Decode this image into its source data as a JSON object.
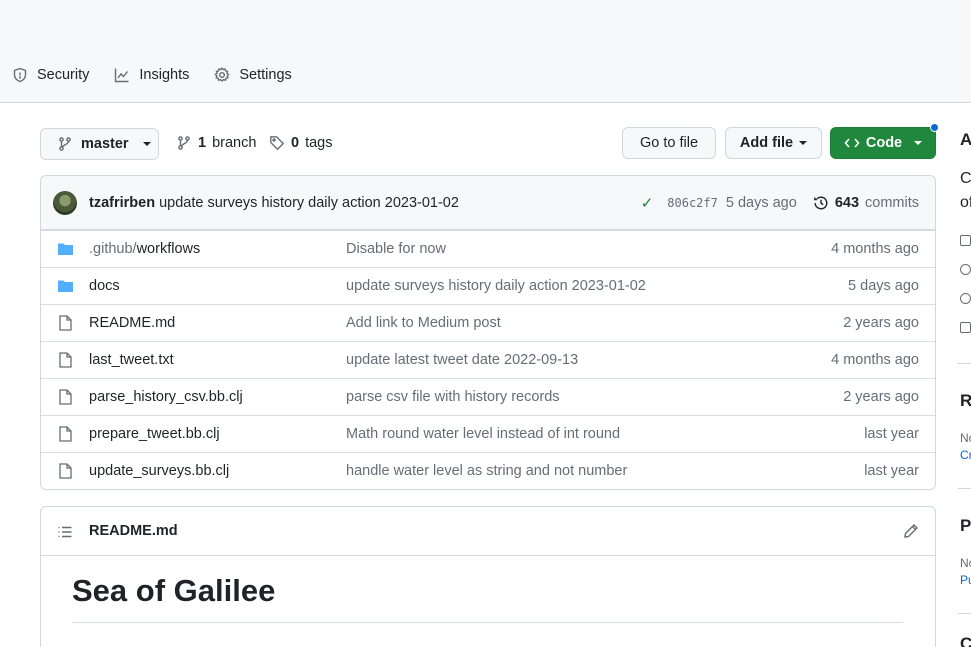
{
  "nav": {
    "items": [
      {
        "label": "Security",
        "icon": "shield-icon"
      },
      {
        "label": "Insights",
        "icon": "graph-icon"
      },
      {
        "label": "Settings",
        "icon": "gear-icon"
      }
    ]
  },
  "toolbar": {
    "branch": "master",
    "branch_count": "1",
    "branch_label": "branch",
    "tag_count": "0",
    "tag_label": "tags",
    "goto_file": "Go to file",
    "add_file": "Add file",
    "code": "Code"
  },
  "latest_commit": {
    "author": "tzafrirben",
    "message": "update surveys history daily action 2023-01-02",
    "sha": "806c2f7",
    "age": "5 days ago",
    "commit_count": "643",
    "commit_label": "commits"
  },
  "files": [
    {
      "type": "dir",
      "name": ".github/workflows",
      "message": "Disable for now",
      "age": "4 months ago"
    },
    {
      "type": "dir",
      "name": "docs",
      "message": "update surveys history daily action 2023-01-02",
      "age": "5 days ago"
    },
    {
      "type": "file",
      "name": "README.md",
      "message": "Add link to Medium post",
      "age": "2 years ago"
    },
    {
      "type": "file",
      "name": "last_tweet.txt",
      "message": "update latest tweet date 2022-09-13",
      "age": "4 months ago"
    },
    {
      "type": "file",
      "name": "parse_history_csv.bb.clj",
      "message": "parse csv file with history records",
      "age": "2 years ago"
    },
    {
      "type": "file",
      "name": "prepare_tweet.bb.clj",
      "message": "Math round water level instead of int round",
      "age": "last year"
    },
    {
      "type": "file",
      "name": "update_surveys.bb.clj",
      "message": "handle water level as string and not number",
      "age": "last year"
    }
  ],
  "readme": {
    "filename": "README.md",
    "heading": "Sea of Galilee"
  },
  "sidebar_clipped": {
    "about_initial": "A",
    "desc_line1": "C",
    "desc_line2": "of",
    "releases_initial": "R",
    "releases_sub": "No",
    "releases_link": "Cr",
    "packages_initial": "Pa",
    "packages_sub": "No",
    "packages_link": "Pu",
    "bottom_initial": "C"
  },
  "colors": {
    "accent_green": "#1f883d",
    "link_blue": "#0969da",
    "folder_blue": "#54aeff",
    "muted": "#656d76"
  }
}
